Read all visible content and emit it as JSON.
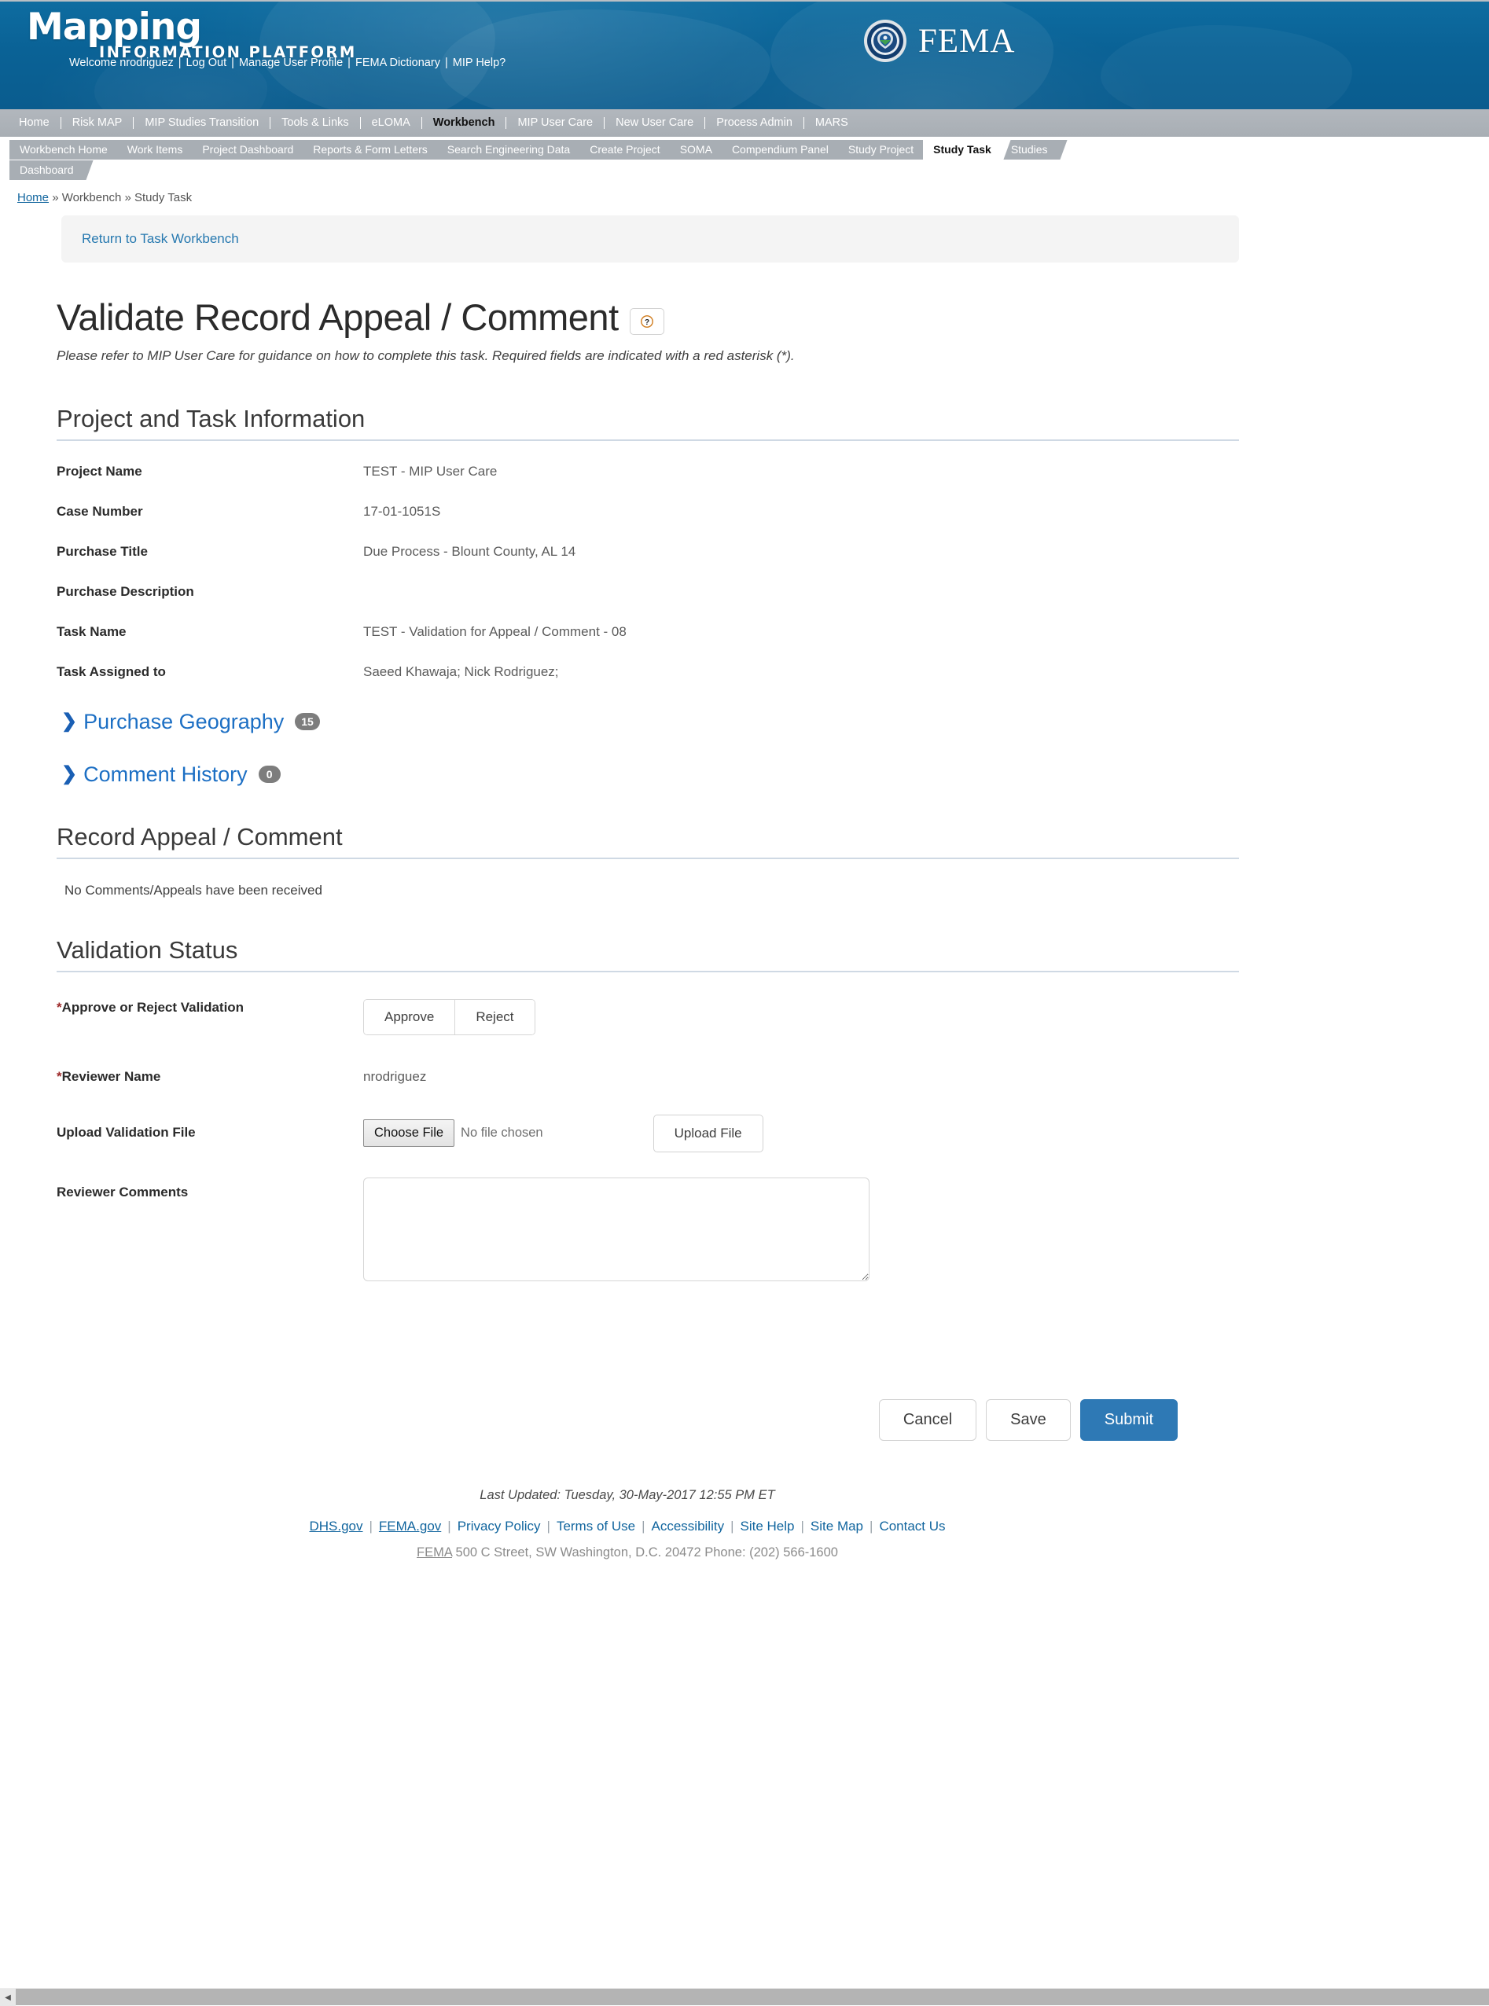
{
  "header": {
    "brand_line1": "Mapping",
    "brand_line2": "INFORMATION PLATFORM",
    "agency": "FEMA",
    "user_links": [
      {
        "label": "Welcome nrodriguez"
      },
      {
        "label": "Log Out"
      },
      {
        "label": "Manage User Profile"
      },
      {
        "label": "FEMA Dictionary"
      },
      {
        "label": "MIP Help?"
      }
    ]
  },
  "primary_nav": [
    {
      "label": "Home",
      "active": false
    },
    {
      "label": "Risk MAP",
      "active": false
    },
    {
      "label": "MIP Studies Transition",
      "active": false
    },
    {
      "label": "Tools & Links",
      "active": false
    },
    {
      "label": "eLOMA",
      "active": false
    },
    {
      "label": "Workbench",
      "active": true
    },
    {
      "label": "MIP User Care",
      "active": false
    },
    {
      "label": "New User Care",
      "active": false
    },
    {
      "label": "Process Admin",
      "active": false
    },
    {
      "label": "MARS",
      "active": false
    }
  ],
  "tabs_row1": [
    {
      "label": "Workbench Home",
      "active": false
    },
    {
      "label": "Work Items",
      "active": false
    },
    {
      "label": "Project Dashboard",
      "active": false
    },
    {
      "label": "Reports & Form Letters",
      "active": false
    },
    {
      "label": "Search Engineering Data",
      "active": false
    },
    {
      "label": "Create Project",
      "active": false
    },
    {
      "label": "SOMA",
      "active": false
    },
    {
      "label": "Compendium Panel",
      "active": false
    },
    {
      "label": "Study Project",
      "active": false
    },
    {
      "label": "Study Task",
      "active": true
    },
    {
      "label": "Studies",
      "active": false
    }
  ],
  "tabs_row2": [
    {
      "label": "Dashboard",
      "active": false
    }
  ],
  "breadcrumb": {
    "home": "Home",
    "sep1": "»",
    "workbench": "Workbench",
    "sep2": "»",
    "current": "Study Task"
  },
  "return_link": "Return to Task Workbench",
  "page": {
    "title": "Validate Record Appeal / Comment",
    "help_icon": "question-mark-icon",
    "subtitle": "Please refer to MIP User Care for guidance on how to complete this task. Required fields are indicated with a red asterisk (*)."
  },
  "project_section": {
    "heading": "Project and Task Information",
    "fields": [
      {
        "label": "Project Name",
        "value": "TEST - MIP User Care"
      },
      {
        "label": "Case Number",
        "value": "17-01-1051S"
      },
      {
        "label": "Purchase Title",
        "value": "Due Process - Blount County, AL 14"
      },
      {
        "label": "Purchase Description",
        "value": ""
      },
      {
        "label": "Task Name",
        "value": "TEST - Validation for Appeal / Comment - 08"
      },
      {
        "label": "Task Assigned to",
        "value": "Saeed Khawaja; Nick Rodriguez;"
      }
    ]
  },
  "accordions": [
    {
      "label": "Purchase Geography",
      "count": "15",
      "icon": "chevron-right-icon"
    },
    {
      "label": "Comment History",
      "count": "0",
      "icon": "chevron-right-icon"
    }
  ],
  "record_section": {
    "heading": "Record Appeal / Comment",
    "empty_message": "No Comments/Appeals have been received"
  },
  "validation_section": {
    "heading": "Validation Status",
    "approve_reject": {
      "label": "Approve or Reject Validation",
      "required": "*",
      "options": [
        "Approve",
        "Reject"
      ]
    },
    "reviewer_name": {
      "label": "Reviewer Name",
      "required": "*",
      "value": "nrodriguez"
    },
    "upload": {
      "label": "Upload Validation File",
      "choose_button": "Choose File",
      "no_file_text": "No file chosen",
      "upload_button": "Upload File"
    },
    "comments": {
      "label": "Reviewer Comments",
      "value": "",
      "placeholder": ""
    }
  },
  "actions": {
    "cancel": "Cancel",
    "save": "Save",
    "submit": "Submit"
  },
  "footer": {
    "last_updated": "Last Updated: Tuesday, 30-May-2017 12:55 PM ET",
    "links": [
      {
        "label": "DHS.gov",
        "underlined": true
      },
      {
        "label": "FEMA.gov",
        "underlined": true
      },
      {
        "label": "Privacy Policy",
        "underlined": false
      },
      {
        "label": "Terms of Use",
        "underlined": false
      },
      {
        "label": "Accessibility",
        "underlined": false
      },
      {
        "label": "Site Help",
        "underlined": false
      },
      {
        "label": "Site Map",
        "underlined": false
      },
      {
        "label": "Contact Us",
        "underlined": false
      }
    ],
    "address_prefix": "FEMA",
    "address": " 500 C Street, SW Washington, D.C. 20472 Phone: (202) 566-1600"
  },
  "colors": {
    "banner_blue": "#0a6296",
    "nav_gray": "#a8aeb4",
    "link_blue": "#11659e",
    "accent_blue": "#1c6fc4",
    "primary_button": "#2e79b5",
    "required_red": "#9d2a2a"
  }
}
